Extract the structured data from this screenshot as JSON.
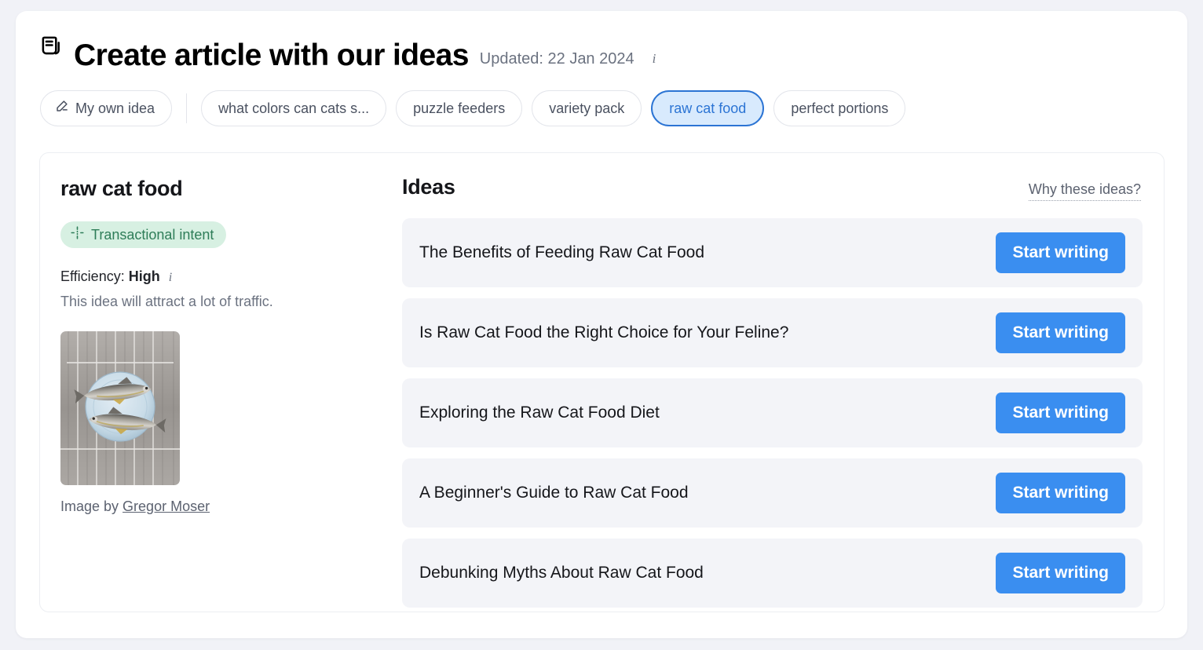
{
  "header": {
    "icon": "article-document-icon",
    "title": "Create article with our ideas",
    "updated": "Updated: 22 Jan 2024",
    "info_icon": "info-icon"
  },
  "pills": {
    "own_idea": {
      "label": "My own idea",
      "icon": "pencil-icon"
    },
    "items": [
      {
        "label": "what colors can cats s...",
        "selected": false
      },
      {
        "label": "puzzle feeders",
        "selected": false
      },
      {
        "label": "variety pack",
        "selected": false
      },
      {
        "label": "raw cat food",
        "selected": true
      },
      {
        "label": "perfect portions",
        "selected": false
      }
    ]
  },
  "keyword_panel": {
    "title": "raw cat food",
    "intent_badge": {
      "label": "Transactional intent",
      "icon": "intent-crosshair-icon"
    },
    "efficiency_label": "Efficiency:",
    "efficiency_value": "High",
    "efficiency_info_icon": "info-icon",
    "efficiency_desc": "This idea will attract a lot of traffic.",
    "image_alt": "two raw trout fish on a light blue plate over weathered grey wooden planks",
    "credit_prefix": "Image by ",
    "credit_author": "Gregor Moser"
  },
  "ideas": {
    "title": "Ideas",
    "why_link": "Why these ideas?",
    "button_label": "Start writing",
    "items": [
      {
        "title": "The Benefits of Feeding Raw Cat Food"
      },
      {
        "title": "Is Raw Cat Food the Right Choice for Your Feline?"
      },
      {
        "title": "Exploring the Raw Cat Food Diet"
      },
      {
        "title": "A Beginner's Guide to Raw Cat Food"
      },
      {
        "title": "Debunking Myths About Raw Cat Food"
      }
    ]
  },
  "colors": {
    "accent_blue": "#3a8ef0",
    "selected_pill_bg": "#d8eafd",
    "selected_pill_border": "#2b74d4",
    "badge_bg": "#d7f0e2",
    "badge_text": "#2e7d58",
    "row_bg": "#f3f4f8",
    "page_bg": "#f1f2f7"
  }
}
